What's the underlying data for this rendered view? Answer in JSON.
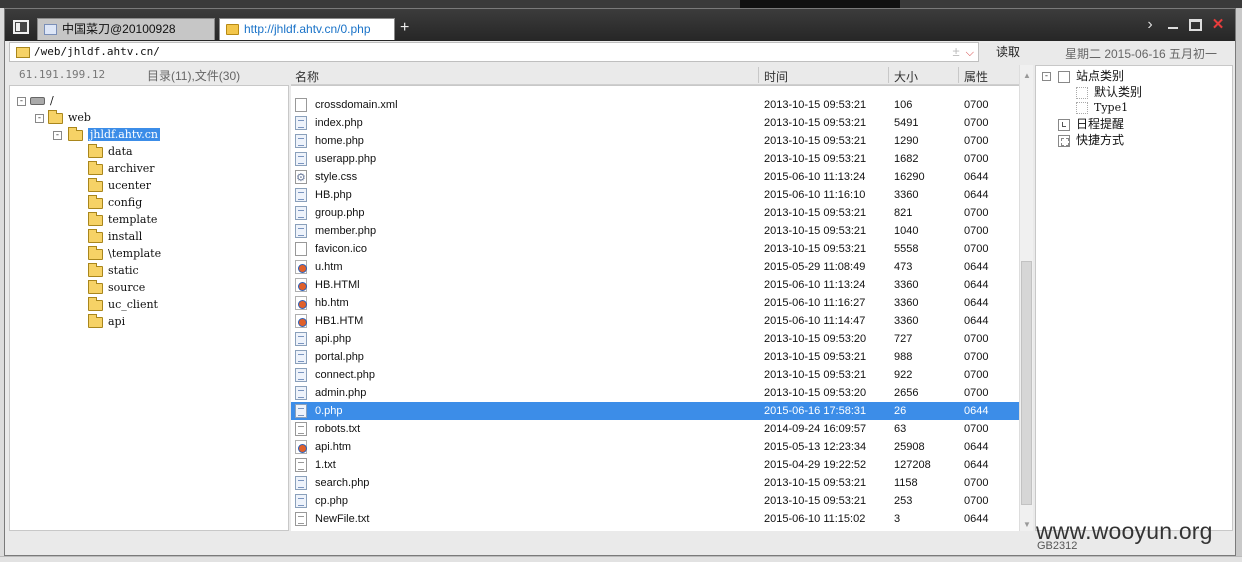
{
  "tabs": [
    {
      "label": "中国菜刀@20100928",
      "active": false
    },
    {
      "label": "http://jhldf.ahtv.cn/0.php",
      "active": true
    }
  ],
  "new_tab_label": "+",
  "window_controls": {
    "menu": "›",
    "close": "✕"
  },
  "address": {
    "path": "/web/jhldf.ahtv.cn/",
    "add_symbol": "±",
    "dropdown_symbol": "⌵",
    "read_button": "读取",
    "date": "星期二 2015-06-16 五月初一"
  },
  "status": {
    "ip": "61.191.199.12",
    "counts": "目录(11),文件(30)"
  },
  "tree": {
    "root": "/",
    "web": "web",
    "site": "jhldf.ahtv.cn",
    "folders": [
      "data",
      "archiver",
      "ucenter",
      "config",
      "template",
      "install",
      "\\template",
      "static",
      "source",
      "uc_client",
      "api"
    ]
  },
  "columns": {
    "name": "名称",
    "time": "时间",
    "size": "大小",
    "attr": "属性"
  },
  "files": [
    {
      "name": "crossdomain.xml",
      "time": "2013-10-15 09:53:21",
      "size": "106",
      "attr": "0700",
      "icon": "blank"
    },
    {
      "name": "index.php",
      "time": "2013-10-15 09:53:21",
      "size": "5491",
      "attr": "0700",
      "icon": "php"
    },
    {
      "name": "home.php",
      "time": "2013-10-15 09:53:21",
      "size": "1290",
      "attr": "0700",
      "icon": "php"
    },
    {
      "name": "userapp.php",
      "time": "2013-10-15 09:53:21",
      "size": "1682",
      "attr": "0700",
      "icon": "php"
    },
    {
      "name": "style.css",
      "time": "2015-06-10 11:13:24",
      "size": "16290",
      "attr": "0644",
      "icon": "css"
    },
    {
      "name": "HB.php",
      "time": "2015-06-10 11:16:10",
      "size": "3360",
      "attr": "0644",
      "icon": "php"
    },
    {
      "name": "group.php",
      "time": "2013-10-15 09:53:21",
      "size": "821",
      "attr": "0700",
      "icon": "php"
    },
    {
      "name": "member.php",
      "time": "2013-10-15 09:53:21",
      "size": "1040",
      "attr": "0700",
      "icon": "php"
    },
    {
      "name": "favicon.ico",
      "time": "2013-10-15 09:53:21",
      "size": "5558",
      "attr": "0700",
      "icon": "blank"
    },
    {
      "name": "u.htm",
      "time": "2015-05-29 11:08:49",
      "size": "473",
      "attr": "0644",
      "icon": "htm"
    },
    {
      "name": "HB.HTMl",
      "time": "2015-06-10 11:13:24",
      "size": "3360",
      "attr": "0644",
      "icon": "htm"
    },
    {
      "name": "hb.htm",
      "time": "2015-06-10 11:16:27",
      "size": "3360",
      "attr": "0644",
      "icon": "htm"
    },
    {
      "name": "HB1.HTM",
      "time": "2015-06-10 11:14:47",
      "size": "3360",
      "attr": "0644",
      "icon": "htm"
    },
    {
      "name": "api.php",
      "time": "2013-10-15 09:53:20",
      "size": "727",
      "attr": "0700",
      "icon": "php"
    },
    {
      "name": "portal.php",
      "time": "2013-10-15 09:53:21",
      "size": "988",
      "attr": "0700",
      "icon": "php"
    },
    {
      "name": "connect.php",
      "time": "2013-10-15 09:53:21",
      "size": "922",
      "attr": "0700",
      "icon": "php"
    },
    {
      "name": "admin.php",
      "time": "2013-10-15 09:53:20",
      "size": "2656",
      "attr": "0700",
      "icon": "php"
    },
    {
      "name": "0.php",
      "time": "2015-06-16 17:58:31",
      "size": "26",
      "attr": "0644",
      "icon": "php",
      "selected": true
    },
    {
      "name": "robots.txt",
      "time": "2014-09-24 16:09:57",
      "size": "63",
      "attr": "0700",
      "icon": "txt"
    },
    {
      "name": "api.htm",
      "time": "2015-05-13 12:23:34",
      "size": "25908",
      "attr": "0644",
      "icon": "htm"
    },
    {
      "name": "1.txt",
      "time": "2015-04-29 19:22:52",
      "size": "127208",
      "attr": "0644",
      "icon": "txt"
    },
    {
      "name": "search.php",
      "time": "2013-10-15 09:53:21",
      "size": "1158",
      "attr": "0700",
      "icon": "php"
    },
    {
      "name": "cp.php",
      "time": "2013-10-15 09:53:21",
      "size": "253",
      "attr": "0700",
      "icon": "php"
    },
    {
      "name": "NewFile.txt",
      "time": "2015-06-10 11:15:02",
      "size": "3",
      "attr": "0644",
      "icon": "txt"
    }
  ],
  "right_panel": {
    "site_category": "站点类别",
    "default_category": "默认类别",
    "type1": "Type1",
    "schedule": "日程提醒",
    "shortcuts": "快捷方式"
  },
  "encoding": "GB2312",
  "watermark": "www.wooyun.org",
  "colors": {
    "selection": "#3c8de8",
    "titlebar": "#2e2e2e",
    "active_tab_text": "#1a73c8",
    "close": "#e83c3c"
  }
}
